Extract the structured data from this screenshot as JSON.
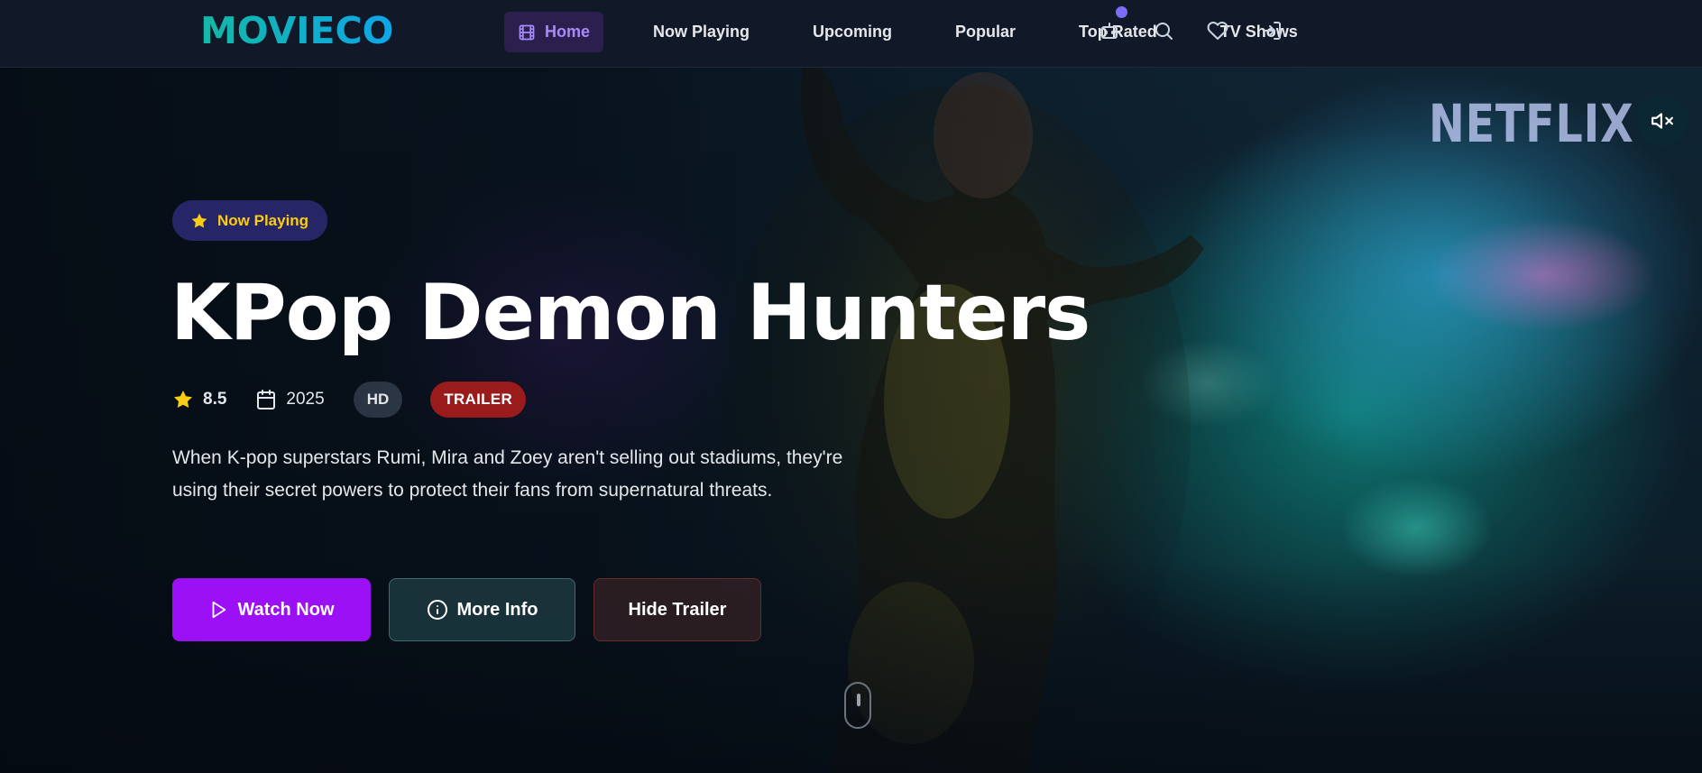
{
  "brand": {
    "logo": "MOVIECO"
  },
  "nav": {
    "items": [
      {
        "label": "Home",
        "icon": "film-icon",
        "active": true
      },
      {
        "label": "Now Playing"
      },
      {
        "label": "Upcoming"
      },
      {
        "label": "Popular"
      },
      {
        "label": "Top Rated"
      },
      {
        "label": "TV Shows"
      }
    ],
    "icons": [
      "bot-icon",
      "search-icon",
      "heart-icon",
      "login-icon"
    ]
  },
  "hero": {
    "badge": "Now Playing",
    "title": "KPop Demon Hunters",
    "rating": "8.5",
    "year": "2025",
    "quality": "HD",
    "tag": "TRAILER",
    "description": "When K-pop superstars Rumi, Mira and Zoey aren't selling out stadiums, they're using their secret powers to protect their fans from supernatural threats.",
    "studio_logo": "NETFLIX",
    "buttons": {
      "watch": "Watch Now",
      "info": "More Info",
      "hide": "Hide Trailer"
    }
  },
  "colors": {
    "accent": "#9b10f5",
    "logo_gradient_start": "#14b8a6",
    "logo_gradient_end": "#0ea5e9",
    "badge_text": "#facc15",
    "trailer_pill": "#991b1b",
    "nav_active_text": "#a78bfa"
  }
}
